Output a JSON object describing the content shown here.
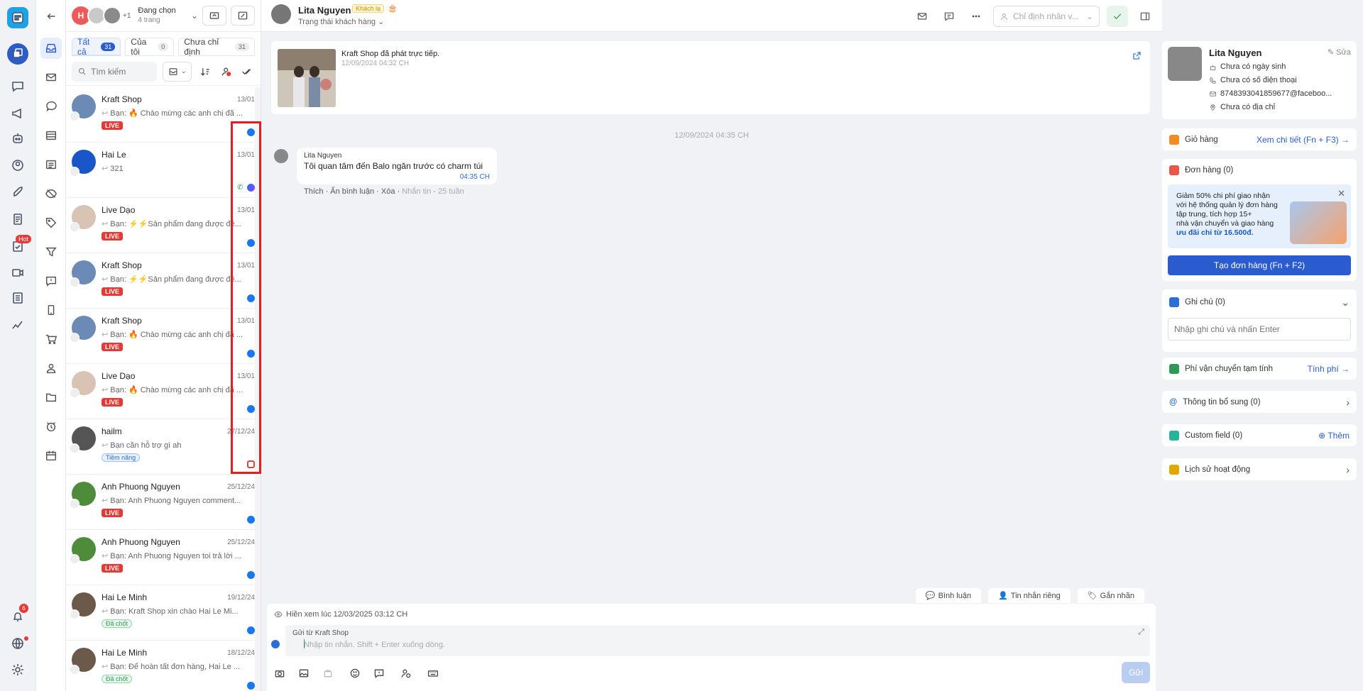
{
  "rail": {
    "hot_label": "Hot",
    "notif_count": "6"
  },
  "pages": {
    "avatar_letter": "H",
    "extra": "+1",
    "selecting": "Đang chọn",
    "page_count": "4 trang"
  },
  "tabs": [
    {
      "label": "Tất cả",
      "count": "31"
    },
    {
      "label": "Của tôi",
      "count": "0"
    },
    {
      "label": "Chưa chỉ định",
      "count": "31"
    }
  ],
  "search": {
    "placeholder": "Tìm kiếm"
  },
  "conversations": [
    {
      "name": "Kraft Shop",
      "date": "13/01",
      "message": "Bạn: 🔥 Chào mừng các anh chị đã ...",
      "tag": "LIVE",
      "tag_kind": "live",
      "channel": "facebook"
    },
    {
      "name": "Hai Le",
      "date": "13/01",
      "message": "321",
      "tag": "",
      "tag_kind": "",
      "channel": "messenger"
    },
    {
      "name": "Live Dạo",
      "date": "13/01",
      "message": "Bạn: ⚡⚡Sản phẩm đang được đề...",
      "tag": "LIVE",
      "tag_kind": "live",
      "channel": "facebook"
    },
    {
      "name": "Kraft Shop",
      "date": "13/01",
      "message": "Bạn: ⚡⚡Sản phẩm đang được đề...",
      "tag": "LIVE",
      "tag_kind": "live",
      "channel": "facebook"
    },
    {
      "name": "Kraft Shop",
      "date": "13/01",
      "message": "Bạn: 🔥 Chào mừng các anh chị đã ...",
      "tag": "LIVE",
      "tag_kind": "live",
      "channel": "facebook"
    },
    {
      "name": "Live Dạo",
      "date": "13/01",
      "message": "Bạn: 🔥 Chào mừng các anh chị đã ...",
      "tag": "LIVE",
      "tag_kind": "live",
      "channel": "facebook"
    },
    {
      "name": "hailm",
      "date": "27/12/24",
      "message": "Bạn cần hỗ trợ gì ah",
      "tag": "Tiềm năng",
      "tag_kind": "blue",
      "channel": "zalo"
    },
    {
      "name": "Anh Phuong Nguyen",
      "date": "25/12/24",
      "message": "Bạn: Anh Phuong Nguyen comment...",
      "tag": "LIVE",
      "tag_kind": "live",
      "channel": "facebook"
    },
    {
      "name": "Anh Phuong Nguyen",
      "date": "25/12/24",
      "message": "Bạn: Anh Phuong Nguyen toi trả lời ...",
      "tag": "LIVE",
      "tag_kind": "live",
      "channel": "facebook"
    },
    {
      "name": "Hai Le Minh",
      "date": "19/12/24",
      "message": "Bạn: Kraft Shop xin chào Hai Le Mi...",
      "tag": "Đã chốt",
      "tag_kind": "green",
      "channel": "facebook"
    },
    {
      "name": "Hai Le Minh",
      "date": "18/12/24",
      "message": "Bạn: Để hoàn tất đơn hàng, Hai Le ...",
      "tag": "Đã chốt",
      "tag_kind": "green",
      "channel": "facebook"
    }
  ],
  "chat_header": {
    "name": "Lita Nguyen",
    "badge": "Khách lạ",
    "status": "Trạng thái khách hàng",
    "assign_placeholder": "Chỉ định nhân v..."
  },
  "live_card": {
    "title": "Kraft Shop đã phát trực tiếp.",
    "time": "12/09/2024 04:32 CH"
  },
  "day_separator": "12/09/2024 04:35 CH",
  "message": {
    "sender": "Lita Nguyen",
    "text": "Tôi quan tâm đến Balo ngăn trước có charm túi",
    "time": "04:35 CH"
  },
  "message_actions": {
    "like": "Thích",
    "hide": "Ẩn bình luận",
    "delete": "Xóa",
    "reply": "Nhắn tin",
    "age": "25 tuần"
  },
  "composer_tabs": {
    "comment": "Bình luận",
    "private": "Tin nhắn riêng",
    "tag": "Gắn nhãn"
  },
  "composer": {
    "seen": "Hiền xem lúc 12/03/2025 03:12 CH",
    "from": "Gửi từ Kraft Shop",
    "placeholder": "Nhập tin nhắn. Shift + Enter xuống dòng.",
    "send": "Gửi"
  },
  "profile": {
    "name": "Lita Nguyen",
    "edit": "Sửa",
    "birthday": "Chưa có ngày sinh",
    "phone": "Chưa có số điện thoại",
    "email": "8748393041859677@faceboo...",
    "address": "Chưa có địa chỉ"
  },
  "cart": {
    "label": "Giỏ hàng",
    "action": "Xem chi tiết (Fn + F3)"
  },
  "orders": {
    "label": "Đơn hàng (0)",
    "promo_line1": "Giảm 50% chi phí giao nhận",
    "promo_line2": "với hệ thống quản lý đơn hàng",
    "promo_line3": "tập trung, tích hợp 15+",
    "promo_line4": "nhà vận chuyển và giao hàng",
    "promo_highlight": "ưu đãi chỉ từ 16.500đ.",
    "create": "Tạo đơn hàng (Fn + F2)"
  },
  "notes": {
    "label": "Ghi chú (0)",
    "placeholder": "Nhập ghi chú và nhấn Enter"
  },
  "shipping": {
    "label": "Phí vận chuyển tạm tính",
    "action": "Tính phí"
  },
  "extra_info": {
    "label": "Thông tin bổ sung (0)"
  },
  "custom_field": {
    "label": "Custom field (0)",
    "action": "Thêm"
  },
  "activity": {
    "label": "Lịch sử hoạt động"
  }
}
